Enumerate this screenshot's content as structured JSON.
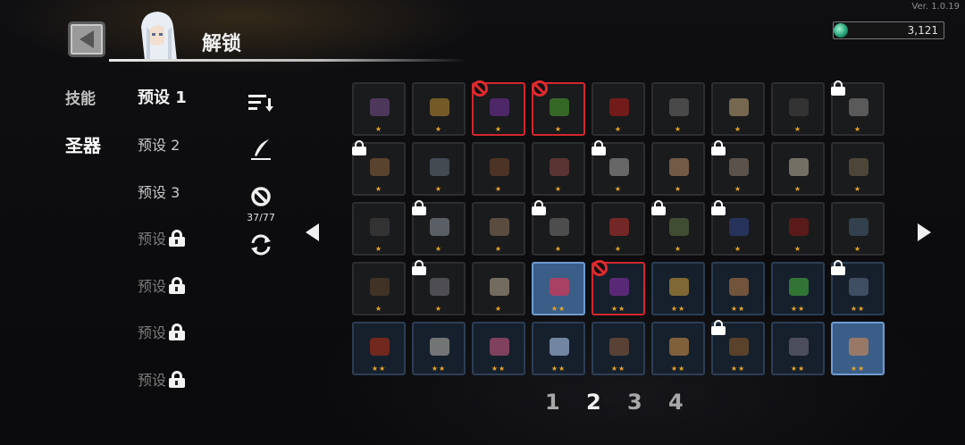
{
  "version": "Ver. 1.0.19",
  "header": {
    "title": "解锁"
  },
  "currency": {
    "value": "3,121"
  },
  "category_tabs": [
    {
      "label": "技能",
      "active": false
    },
    {
      "label": "圣器",
      "active": true
    }
  ],
  "presets": [
    {
      "label": "预设 1",
      "state": "active"
    },
    {
      "label": "预设 2",
      "state": "normal"
    },
    {
      "label": "预设 3",
      "state": "normal"
    },
    {
      "label": "预设",
      "state": "locked"
    },
    {
      "label": "预设",
      "state": "locked"
    },
    {
      "label": "预设",
      "state": "locked"
    },
    {
      "label": "预设",
      "state": "locked"
    }
  ],
  "tools": {
    "ban_count": "37/77"
  },
  "slots": [
    {
      "stars": "★",
      "tier": 1,
      "lock": false,
      "ban": false,
      "sel": false,
      "color": "#5a3f6a"
    },
    {
      "stars": "★",
      "tier": 1,
      "lock": false,
      "ban": false,
      "sel": false,
      "color": "#8a6a2a"
    },
    {
      "stars": "★",
      "tier": 1,
      "lock": false,
      "ban": true,
      "sel": false,
      "color": "#5a2a7a"
    },
    {
      "stars": "★",
      "tier": 1,
      "lock": false,
      "ban": true,
      "sel": false,
      "color": "#3c7a2a"
    },
    {
      "stars": "★",
      "tier": 1,
      "lock": false,
      "ban": false,
      "sel": false,
      "color": "#8a1c1c"
    },
    {
      "stars": "★",
      "tier": 1,
      "lock": false,
      "ban": false,
      "sel": false,
      "color": "#555555"
    },
    {
      "stars": "★",
      "tier": 1,
      "lock": false,
      "ban": false,
      "sel": false,
      "color": "#8d7a5e"
    },
    {
      "stars": "★",
      "tier": 1,
      "lock": false,
      "ban": false,
      "sel": false,
      "color": "#3a3a3a"
    },
    {
      "stars": "★",
      "tier": 1,
      "lock": true,
      "ban": false,
      "sel": false,
      "color": "#6a6a6a"
    },
    {
      "stars": "★",
      "tier": 1,
      "lock": true,
      "ban": false,
      "sel": false,
      "color": "#6a4d33"
    },
    {
      "stars": "★",
      "tier": 1,
      "lock": false,
      "ban": false,
      "sel": false,
      "color": "#4d5660"
    },
    {
      "stars": "★",
      "tier": 1,
      "lock": false,
      "ban": false,
      "sel": false,
      "color": "#5a3a28"
    },
    {
      "stars": "★",
      "tier": 1,
      "lock": false,
      "ban": false,
      "sel": false,
      "color": "#6a3a3a"
    },
    {
      "stars": "★",
      "tier": 1,
      "lock": true,
      "ban": false,
      "sel": false,
      "color": "#7a7a7a"
    },
    {
      "stars": "★",
      "tier": 1,
      "lock": false,
      "ban": false,
      "sel": false,
      "color": "#8a6a52"
    },
    {
      "stars": "★",
      "tier": 1,
      "lock": true,
      "ban": false,
      "sel": false,
      "color": "#6a6058"
    },
    {
      "stars": "★",
      "tier": 1,
      "lock": false,
      "ban": false,
      "sel": false,
      "color": "#8a8578"
    },
    {
      "stars": "★",
      "tier": 1,
      "lock": false,
      "ban": false,
      "sel": false,
      "color": "#5a5040"
    },
    {
      "stars": "★",
      "tier": 1,
      "lock": false,
      "ban": false,
      "sel": false,
      "color": "#3a3a3a"
    },
    {
      "stars": "★",
      "tier": 1,
      "lock": true,
      "ban": false,
      "sel": false,
      "color": "#6a7078"
    },
    {
      "stars": "★",
      "tier": 1,
      "lock": false,
      "ban": false,
      "sel": false,
      "color": "#6a5a48"
    },
    {
      "stars": "★",
      "tier": 1,
      "lock": true,
      "ban": false,
      "sel": false,
      "color": "#5a5a5a"
    },
    {
      "stars": "★",
      "tier": 1,
      "lock": false,
      "ban": false,
      "sel": false,
      "color": "#8a2a2a"
    },
    {
      "stars": "★",
      "tier": 1,
      "lock": true,
      "ban": false,
      "sel": false,
      "color": "#4a5a3a"
    },
    {
      "stars": "★",
      "tier": 1,
      "lock": true,
      "ban": false,
      "sel": false,
      "color": "#2a3a6a"
    },
    {
      "stars": "★",
      "tier": 1,
      "lock": false,
      "ban": false,
      "sel": false,
      "color": "#6a1a1a"
    },
    {
      "stars": "★",
      "tier": 1,
      "lock": false,
      "ban": false,
      "sel": false,
      "color": "#3a4a5a"
    },
    {
      "stars": "★",
      "tier": 1,
      "lock": false,
      "ban": false,
      "sel": false,
      "color": "#4a3a28"
    },
    {
      "stars": "★",
      "tier": 1,
      "lock": true,
      "ban": false,
      "sel": false,
      "color": "#5a5a60"
    },
    {
      "stars": "★",
      "tier": 1,
      "lock": false,
      "ban": false,
      "sel": false,
      "color": "#8a8070"
    },
    {
      "stars": "★★",
      "tier": 2,
      "lock": false,
      "ban": false,
      "sel": true,
      "color": "#c43a5a"
    },
    {
      "stars": "★★",
      "tier": 2,
      "lock": false,
      "ban": true,
      "sel": false,
      "color": "#6a2a8a"
    },
    {
      "stars": "★★",
      "tier": 2,
      "lock": false,
      "ban": false,
      "sel": false,
      "color": "#9a7a3a"
    },
    {
      "stars": "★★",
      "tier": 2,
      "lock": false,
      "ban": false,
      "sel": false,
      "color": "#8a6040"
    },
    {
      "stars": "★★",
      "tier": 2,
      "lock": false,
      "ban": false,
      "sel": false,
      "color": "#3a8a3a"
    },
    {
      "stars": "★★",
      "tier": 2,
      "lock": true,
      "ban": false,
      "sel": false,
      "color": "#4a5a70"
    },
    {
      "stars": "★★",
      "tier": 2,
      "lock": false,
      "ban": false,
      "sel": false,
      "color": "#8a2a1a"
    },
    {
      "stars": "★★",
      "tier": 2,
      "lock": false,
      "ban": false,
      "sel": false,
      "color": "#8a8a8a"
    },
    {
      "stars": "★★",
      "tier": 2,
      "lock": false,
      "ban": false,
      "sel": false,
      "color": "#9a4a6a"
    },
    {
      "stars": "★★",
      "tier": 2,
      "lock": false,
      "ban": false,
      "sel": false,
      "color": "#8aa0c0"
    },
    {
      "stars": "★★",
      "tier": 2,
      "lock": false,
      "ban": false,
      "sel": false,
      "color": "#6a4a3a"
    },
    {
      "stars": "★★",
      "tier": 2,
      "lock": false,
      "ban": false,
      "sel": false,
      "color": "#9a7040"
    },
    {
      "stars": "★★",
      "tier": 2,
      "lock": true,
      "ban": false,
      "sel": false,
      "color": "#6a4a2a"
    },
    {
      "stars": "★★",
      "tier": 2,
      "lock": false,
      "ban": false,
      "sel": false,
      "color": "#5a5a6a"
    },
    {
      "stars": "★★",
      "tier": 2,
      "lock": false,
      "ban": false,
      "sel": true,
      "color": "#b08060"
    }
  ],
  "pagination": {
    "pages": [
      "1",
      "2",
      "3",
      "4"
    ],
    "active_index": 1
  },
  "colors": {
    "accent_blue": "#3a5e88",
    "ban_red": "#e02a2f",
    "star_gold": "#e8a426"
  }
}
